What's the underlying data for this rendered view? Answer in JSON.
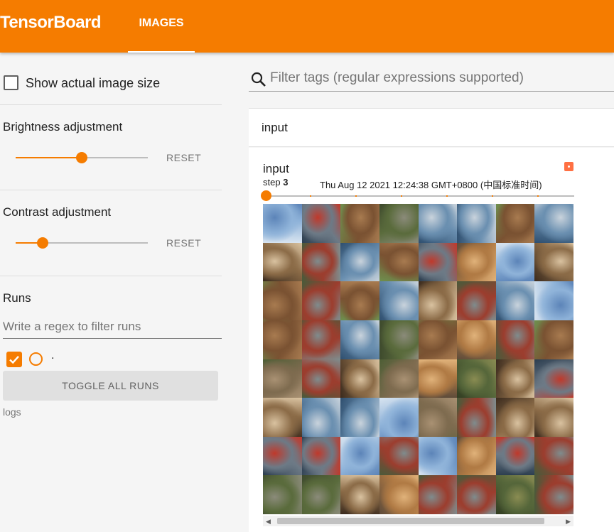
{
  "header": {
    "brand": "TensorBoard",
    "active_tab": "IMAGES"
  },
  "sidebar": {
    "show_actual_size": {
      "label": "Show actual image size",
      "checked": false
    },
    "brightness": {
      "title": "Brightness adjustment",
      "reset_label": "RESET",
      "value": 0.5
    },
    "contrast": {
      "title": "Contrast adjustment",
      "reset_label": "RESET",
      "value": 0.2
    },
    "runs": {
      "title": "Runs",
      "filter_placeholder": "Write a regex to filter runs",
      "items": [
        {
          "name": ".",
          "checked": true,
          "color": "#f57c00"
        }
      ],
      "toggle_label": "TOGGLE ALL RUNS",
      "dir_label": "logs"
    }
  },
  "main": {
    "filter_placeholder": "Filter tags (regular expressions supported)",
    "group": {
      "title": "input"
    },
    "card": {
      "title": "input",
      "step_label": "step",
      "step_value": "3",
      "timestamp": "Thu Aug 12 2021 12:24:38 GMT+0800 (中国标准时间)",
      "step_position": 0
    },
    "image_grid": {
      "rows": 8,
      "cols": 8,
      "cells": [
        [
          "airplane",
          "car",
          "horse",
          "bird",
          "ship",
          "ship",
          "horse",
          "ship"
        ],
        [
          "dog",
          "truck",
          "ship",
          "horse",
          "car",
          "cat",
          "airplane",
          "dog"
        ],
        [
          "horse",
          "truck",
          "horse",
          "ship",
          "dog",
          "truck",
          "ship",
          "airplane"
        ],
        [
          "horse",
          "truck",
          "ship",
          "bird",
          "horse",
          "cat",
          "truck",
          "horse"
        ],
        [
          "deer",
          "truck",
          "dog",
          "deer",
          "cat",
          "frog",
          "dog",
          "car"
        ],
        [
          "dog",
          "ship",
          "ship",
          "airplane",
          "deer",
          "truck",
          "dog",
          "dog"
        ],
        [
          "car",
          "car",
          "airplane",
          "truck",
          "airplane",
          "cat",
          "car",
          "truck"
        ],
        [
          "bird",
          "bird",
          "dog",
          "cat",
          "truck",
          "truck",
          "frog",
          "truck"
        ]
      ]
    }
  },
  "colors": {
    "accent": "#f57c00",
    "run": "#ff7043"
  }
}
